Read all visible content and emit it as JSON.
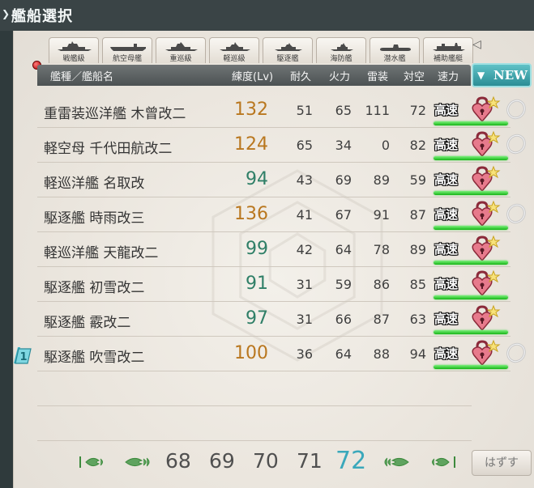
{
  "window": {
    "title": "艦船選択"
  },
  "tabs": [
    {
      "label": "戦艦級",
      "icon": "battleship-silhouette-icon"
    },
    {
      "label": "航空母艦",
      "icon": "carrier-silhouette-icon"
    },
    {
      "label": "重巡級",
      "icon": "heavy-cruiser-silhouette-icon"
    },
    {
      "label": "軽巡級",
      "icon": "light-cruiser-silhouette-icon"
    },
    {
      "label": "駆逐艦",
      "icon": "destroyer-silhouette-icon"
    },
    {
      "label": "海防艦",
      "icon": "escort-silhouette-icon"
    },
    {
      "label": "潜水艦",
      "icon": "submarine-silhouette-icon"
    },
    {
      "label": "補助艦艇",
      "icon": "auxiliary-silhouette-icon"
    }
  ],
  "header": {
    "name": "艦種／艦船名",
    "level": "練度(Lv)",
    "hp": "耐久",
    "firepower": "火力",
    "torpedo": "雷装",
    "aa": "対空",
    "speed": "速力",
    "sort_label": "NEW"
  },
  "ships": [
    {
      "name": "重雷装巡洋艦 木曾改二",
      "level": "132",
      "hp": "51",
      "firepower": "65",
      "torpedo": "111",
      "aa": "72",
      "speed": "高速",
      "ring": true
    },
    {
      "name": "軽空母 千代田航改二",
      "level": "124",
      "hp": "65",
      "firepower": "34",
      "torpedo": "0",
      "aa": "82",
      "speed": "高速",
      "ring": true
    },
    {
      "name": "軽巡洋艦 名取改",
      "level": "94",
      "hp": "43",
      "firepower": "69",
      "torpedo": "89",
      "aa": "59",
      "speed": "高速",
      "ring": false
    },
    {
      "name": "駆逐艦 時雨改三",
      "level": "136",
      "hp": "41",
      "firepower": "67",
      "torpedo": "91",
      "aa": "87",
      "speed": "高速",
      "ring": true
    },
    {
      "name": "軽巡洋艦 天龍改二",
      "level": "99",
      "hp": "42",
      "firepower": "64",
      "torpedo": "78",
      "aa": "89",
      "speed": "高速",
      "ring": false
    },
    {
      "name": "駆逐艦 初雪改二",
      "level": "91",
      "hp": "31",
      "firepower": "59",
      "torpedo": "86",
      "aa": "85",
      "speed": "高速",
      "ring": false
    },
    {
      "name": "駆逐艦 霰改二",
      "level": "97",
      "hp": "31",
      "firepower": "66",
      "torpedo": "87",
      "aa": "63",
      "speed": "高速",
      "ring": false
    },
    {
      "name": "駆逐艦 吹雪改二",
      "level": "100",
      "hp": "36",
      "firepower": "64",
      "torpedo": "88",
      "aa": "94",
      "speed": "高速",
      "ring": true,
      "fleet_marker": "1"
    }
  ],
  "pagination": {
    "pages": [
      "68",
      "69",
      "70",
      "71",
      "72"
    ],
    "current": "72"
  },
  "release_button": "はずす",
  "colors": {
    "level_high": "#b9771f",
    "level_normal": "#2f7f67",
    "accent": "#3aa8bb"
  }
}
